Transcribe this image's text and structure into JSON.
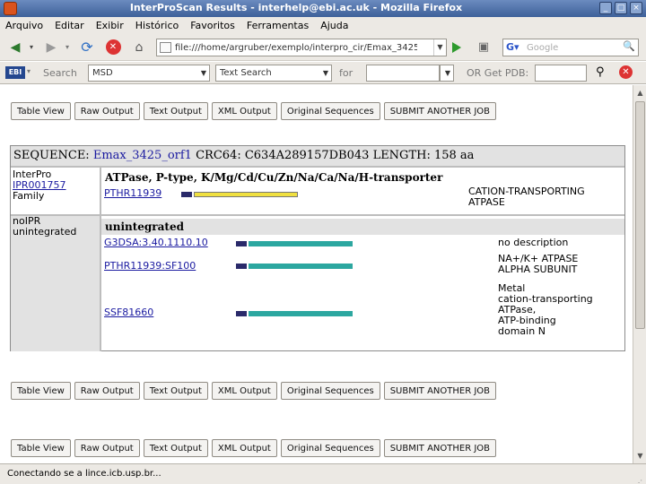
{
  "window": {
    "title": "InterProScan Results - interhelp@ebi.ac.uk - Mozilla Firefox",
    "controls": [
      "_",
      "□",
      "×"
    ]
  },
  "menu": [
    "Arquivo",
    "Editar",
    "Exibir",
    "Histórico",
    "Favoritos",
    "Ferramentas",
    "Ajuda"
  ],
  "nav": {
    "url": "file:///home/argruber/exemplo/interpro_cir/Emax_3425",
    "search_placeholder": "Google"
  },
  "ipr_toolbar": {
    "search_label": "Search",
    "db_select": "MSD",
    "search_type": "Text Search",
    "for_label": "for",
    "pdb_label": "OR Get PDB:"
  },
  "buttons": [
    "Table View",
    "Raw Output",
    "Text Output",
    "XML Output",
    "Original Sequences",
    "SUBMIT ANOTHER JOB"
  ],
  "result": {
    "seq_label": "SEQUENCE:",
    "seq_name": "Emax_3425_orf1",
    "crc_label": "CRC64:",
    "crc_value": "C634A289157DB043",
    "length_label": "LENGTH:",
    "length_value": "158 aa",
    "entries": [
      {
        "db_line1": "InterPro",
        "accession": "IPR001757",
        "type": "Family",
        "title": "ATPase, P-type, K/Mg/Cd/Cu/Zn/Na/Ca/Na/H-transporter",
        "hits": [
          {
            "id": "PTHR11939",
            "desc_lines": [
              "CATION-TRANSPORTING",
              "ATPASE"
            ]
          }
        ]
      },
      {
        "db_line1": "noIPR",
        "db_line2": "unintegrated",
        "title": "unintegrated",
        "hits": [
          {
            "id": "G3DSA:3.40.1110.10",
            "desc_lines": [
              "no description"
            ]
          },
          {
            "id": "PTHR11939:SF100",
            "desc_lines": [
              "NA+/K+ ATPASE",
              "ALPHA SUBUNIT"
            ]
          },
          {
            "id": "SSF81660",
            "desc_lines": [
              "Metal",
              "cation-transporting",
              "ATPase,",
              "ATP-binding",
              "domain N"
            ]
          }
        ]
      }
    ]
  },
  "status": "Conectando se a lince.icb.usp.br...",
  "colors": {
    "family_bar": "#f0e040",
    "unintegrated_bar": "#2ca7a0",
    "match_block": "#2a2a6a"
  },
  "icons": [
    "back-arrow-icon",
    "forward-arrow-icon",
    "reload-icon",
    "stop-icon",
    "home-icon",
    "go-icon",
    "google-icon",
    "search-icon",
    "ebi-logo-icon",
    "magic-wand-icon",
    "close-icon"
  ]
}
